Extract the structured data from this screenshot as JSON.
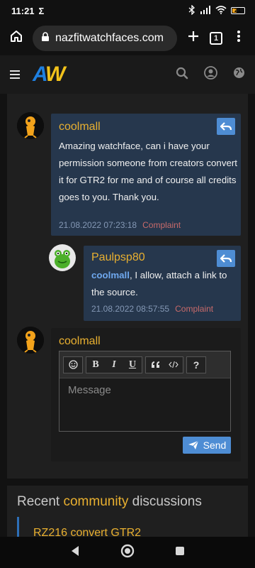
{
  "status": {
    "time": "11:21",
    "sigma": "Σ",
    "battery": "21"
  },
  "browser": {
    "url": "nazfitwatchfaces.com",
    "tabs_count": "1"
  },
  "site": {
    "logo_a": "A",
    "logo_w": "W"
  },
  "comments": [
    {
      "author": "coolmall",
      "text": "Amazing watchface, can i have your permission someone from creators convert it for GTR2 for me and of course all credits goes to you. Thank you.",
      "date": "21.08.2022 07:23:18",
      "complaint": "Complaint"
    },
    {
      "author": "Paulpsp80",
      "mention": "coolmall",
      "text": ", I allow, attach a link to the source.",
      "date": "21.08.2022 08:57:55",
      "complaint": "Complaint"
    }
  ],
  "reply_form": {
    "author": "coolmall",
    "placeholder": "Message",
    "send_label": "Send",
    "toolbar": {
      "bold": "B",
      "italic": "I",
      "underline": "U",
      "help": "?"
    }
  },
  "recent": {
    "title_prefix": "Recent ",
    "title_highlight": "community",
    "title_suffix": " discussions",
    "first_item": "RZ216 convert GTR2"
  }
}
